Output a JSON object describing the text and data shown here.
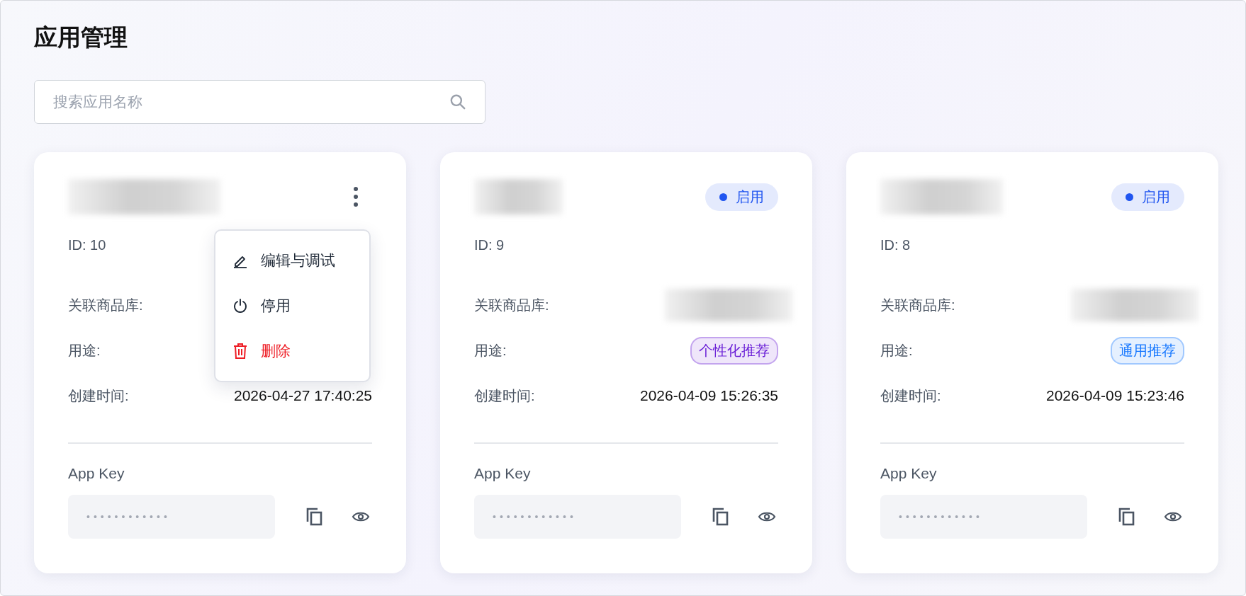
{
  "title": "应用管理",
  "search": {
    "placeholder": "搜索应用名称"
  },
  "apps": [
    {
      "id_text": "ID: 10",
      "menu_open": true,
      "menu": [
        {
          "kind": "edit",
          "label": "编辑与调试",
          "danger": false
        },
        {
          "kind": "power",
          "label": "停用",
          "danger": false
        },
        {
          "kind": "delete",
          "label": "删除",
          "danger": true
        }
      ],
      "library_label": "关联商品库:",
      "purpose_label": "用途:",
      "created_label": "创建时间:",
      "created": "2026-04-27 17:40:25",
      "key_label": "App Key",
      "key_mask": "••••••••••••"
    },
    {
      "id_text": "ID: 9",
      "menu_open": false,
      "status": {
        "label": "启用",
        "color": "#2055f0"
      },
      "library_label": "关联商品库:",
      "purpose_label": "用途:",
      "purpose": {
        "label": "个性化推荐",
        "color": "#6a1fd6"
      },
      "created_label": "创建时间:",
      "created": "2026-04-09 15:26:35",
      "key_label": "App Key",
      "key_mask": "••••••••••••"
    },
    {
      "id_text": "ID: 8",
      "menu_open": false,
      "status": {
        "label": "启用",
        "color": "#2055f0"
      },
      "library_label": "关联商品库:",
      "purpose_label": "用途:",
      "purpose": {
        "label": "通用推荐",
        "color": "#1677ff"
      },
      "created_label": "创建时间:",
      "created": "2026-04-09 15:23:46",
      "key_label": "App Key",
      "key_mask": "••••••••••••"
    }
  ]
}
